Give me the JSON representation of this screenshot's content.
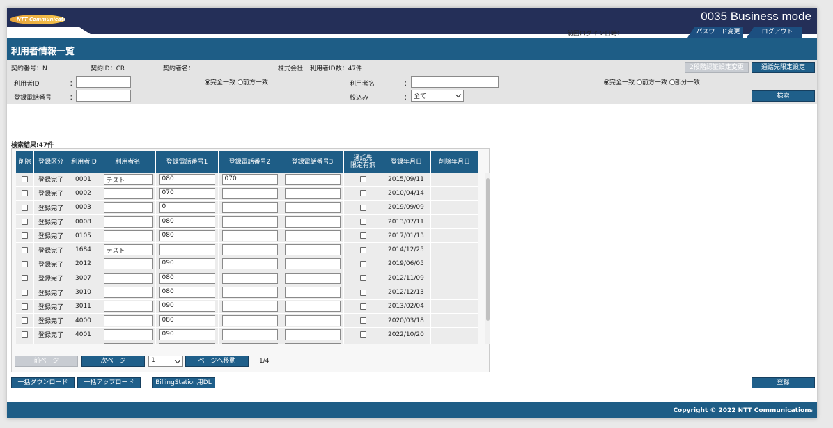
{
  "header": {
    "logo_text": "NTT Communications",
    "brand": "0035 Business mode",
    "last_login_label": "前回ログイン日時：",
    "password_change": "パスワード変更",
    "logout": "ログアウト"
  },
  "page_title": "利用者情報一覧",
  "contract": {
    "number_label": "契約番号：N",
    "id_label": "契約ID：CR",
    "name_label": "契約者名：",
    "company": "株式会社",
    "user_count": "利用者ID数：47件",
    "btn_2fa": "2段階認証設定変更",
    "btn_callee": "通話先限定設定"
  },
  "filters": {
    "user_id_label": "利用者ID",
    "phone_label": "登録電話番号",
    "colon": "：",
    "match_exact": "完全一致",
    "match_prefix": "前方一致",
    "match_partial": "部分一致",
    "user_name_label": "利用者名",
    "narrow_label": "絞込み",
    "narrow_value": "全て",
    "search_btn": "検索"
  },
  "result_label": "検索結果:47件",
  "table": {
    "headers": [
      "削除",
      "登録区分",
      "利用者ID",
      "利用者名",
      "登録電話番号1",
      "登録電話番号2",
      "登録電話番号3",
      "通話先\n限定有無",
      "登録年月日",
      "削除年月日"
    ],
    "rows": [
      {
        "status": "登録完了",
        "id": "0001",
        "name": "テスト",
        "p1": "080",
        "p2": "070",
        "p3": "",
        "date": "2015/09/11"
      },
      {
        "status": "登録完了",
        "id": "0002",
        "name": "",
        "p1": "070",
        "p2": "",
        "p3": "",
        "date": "2010/04/14"
      },
      {
        "status": "登録完了",
        "id": "0003",
        "name": "",
        "p1": "0",
        "p2": "",
        "p3": "",
        "date": "2019/09/09"
      },
      {
        "status": "登録完了",
        "id": "0008",
        "name": "",
        "p1": "080",
        "p2": "",
        "p3": "",
        "date": "2013/07/11"
      },
      {
        "status": "登録完了",
        "id": "0105",
        "name": "",
        "p1": "080",
        "p2": "",
        "p3": "",
        "date": "2017/01/13"
      },
      {
        "status": "登録完了",
        "id": "1684",
        "name": "テスト",
        "p1": "",
        "p2": "",
        "p3": "",
        "date": "2014/12/25"
      },
      {
        "status": "登録完了",
        "id": "2012",
        "name": "",
        "p1": "090",
        "p2": "",
        "p3": "",
        "date": "2019/06/05"
      },
      {
        "status": "登録完了",
        "id": "3007",
        "name": "",
        "p1": "080",
        "p2": "",
        "p3": "",
        "date": "2012/11/09"
      },
      {
        "status": "登録完了",
        "id": "3010",
        "name": "",
        "p1": "080",
        "p2": "",
        "p3": "",
        "date": "2012/12/13"
      },
      {
        "status": "登録完了",
        "id": "3011",
        "name": "",
        "p1": "090",
        "p2": "",
        "p3": "",
        "date": "2013/02/04"
      },
      {
        "status": "登録完了",
        "id": "4000",
        "name": "",
        "p1": "080",
        "p2": "",
        "p3": "",
        "date": "2020/03/18"
      },
      {
        "status": "登録完了",
        "id": "4001",
        "name": "",
        "p1": "090",
        "p2": "",
        "p3": "",
        "date": "2022/10/20"
      },
      {
        "status": "",
        "id": "",
        "name": "",
        "p1": "",
        "p2": "",
        "p3": "",
        "date": ""
      }
    ]
  },
  "pager": {
    "prev": "前ページ",
    "next": "次ページ",
    "page_value": "1",
    "goto": "ページへ移動",
    "position": "1/4"
  },
  "actions": {
    "bulk_download": "一括ダウンロード",
    "bulk_upload": "一括アップロード",
    "billing_dl": "BillingStation用DL",
    "register": "登録"
  },
  "footer": {
    "copyright": "Copyright © 2022 NTT Communications"
  },
  "colors": {
    "navy": "#242f58",
    "header_blue": "#1e5d86",
    "button_blue": "#1f5f8a"
  }
}
